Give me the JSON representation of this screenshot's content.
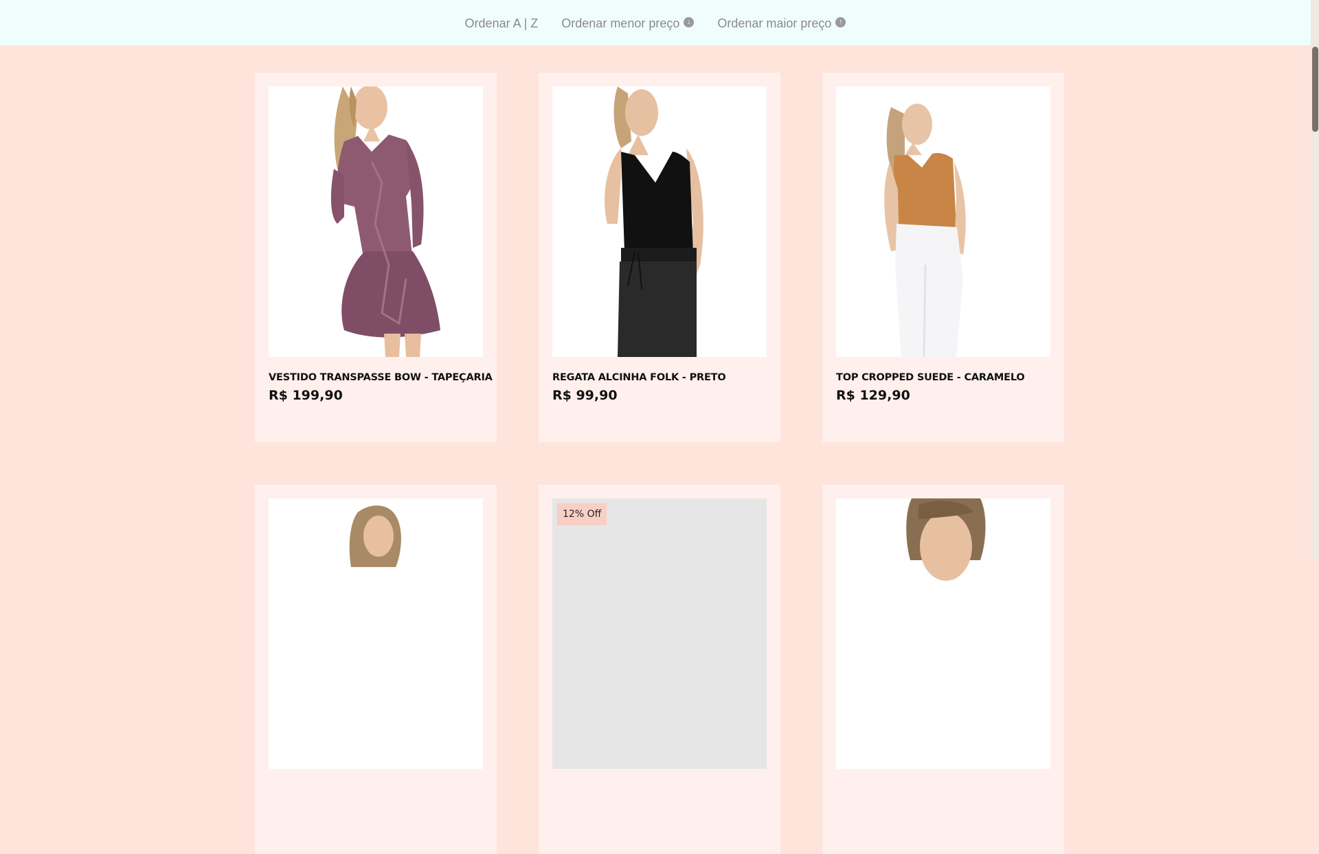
{
  "sort_bar": {
    "az_label": "Ordenar A | Z",
    "low_label": "Ordenar menor preço",
    "high_label": "Ordenar maior preço",
    "low_icon": "arrow-down-circle-icon",
    "high_icon": "arrow-up-circle-icon"
  },
  "products": [
    {
      "name": "VESTIDO TRANSPASSE BOW - TAPEÇARIA",
      "price": "R$ 199,90"
    },
    {
      "name": "REGATA ALCINHA FOLK - PRETO",
      "price": "R$ 99,90"
    },
    {
      "name": "TOP CROPPED SUEDE - CARAMELO",
      "price": "R$ 129,90"
    },
    {
      "name": "",
      "price": ""
    },
    {
      "name": "",
      "price": "",
      "badge": "12% Off"
    },
    {
      "name": "",
      "price": ""
    }
  ],
  "colors": {
    "page_bg": "#ffe4dc",
    "topbar_bg": "#f0fdfd",
    "card_bg": "#fff0ed",
    "badge_bg": "#f9cfc4"
  }
}
